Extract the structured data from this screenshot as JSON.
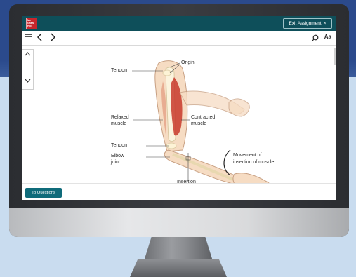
{
  "app": {
    "logo_text": "Mc Graw Hill",
    "exit_label": "Exit Assignment",
    "exit_icon": "×"
  },
  "nav": {
    "menu_icon": "hamburger-icon",
    "back_icon": "chevron-left-icon",
    "forward_icon": "chevron-right-icon",
    "search_icon": "search-icon",
    "text_size_label": "Aa"
  },
  "figure": {
    "labels": {
      "tendon_top": "Tendon",
      "origin": "Origin",
      "relaxed_1": "Relaxed",
      "relaxed_2": "muscle",
      "contracted_1": "Contracted",
      "contracted_2": "muscle",
      "tendon_bottom": "Tendon",
      "elbow_1": "Elbow",
      "elbow_2": "joint",
      "movement_1": "Movement of",
      "movement_2": "insertion of muscle",
      "insertion": "Insertion"
    }
  },
  "footer": {
    "to_questions_label": "To Questions"
  },
  "colors": {
    "header_teal": "#0e4f5a",
    "button_teal": "#0f6b7a",
    "background_blue": "#2b4a8c",
    "logo_red": "#c8262c"
  }
}
